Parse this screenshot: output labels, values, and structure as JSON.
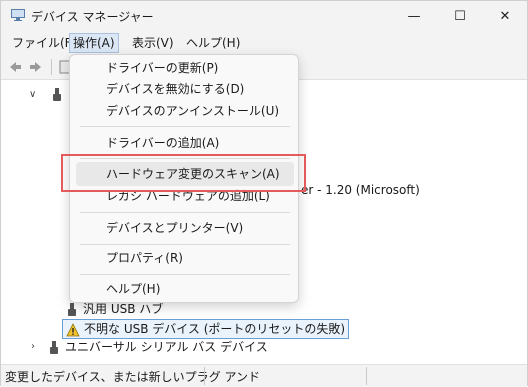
{
  "window": {
    "title": "デバイス マネージャー",
    "controls": [
      "—",
      "☐",
      "✕"
    ]
  },
  "menubar": {
    "items": [
      "ファイル(F)",
      "操作(A)",
      "表示(V)",
      "ヘルプ(H)"
    ],
    "active_index": 1
  },
  "dropdown": {
    "items": [
      "ドライバーの更新(P)",
      "デバイスを無効にする(D)",
      "デバイスのアンインストール(U)",
      "ドライバーの追加(A)",
      "ハードウェア変更のスキャン(A)",
      "レガシ ハードウェアの追加(L)",
      "デバイスとプリンター(V)",
      "プロパティ(R)",
      "ヘルプ(H)"
    ],
    "highlighted_index": 4
  },
  "tree": {
    "partial_text": "er - 1.20 (Microsoft)",
    "rows": [
      {
        "label": "汎用 USB ハブ",
        "icon": "usb-icon"
      },
      {
        "label": "不明な USB デバイス (ポートのリセットの失敗)",
        "icon": "warning-icon"
      },
      {
        "label": "ユニバーサル シリアル バス デバイス",
        "icon": "usb-icon"
      }
    ]
  },
  "statusbar": {
    "text": "変更したデバイス、または新しいプラグ アンド"
  },
  "colors": {
    "highlight_box": "#e35b5b",
    "selection_border": "#6a9fd6",
    "menu_active_bg": "#dbe7f5"
  }
}
